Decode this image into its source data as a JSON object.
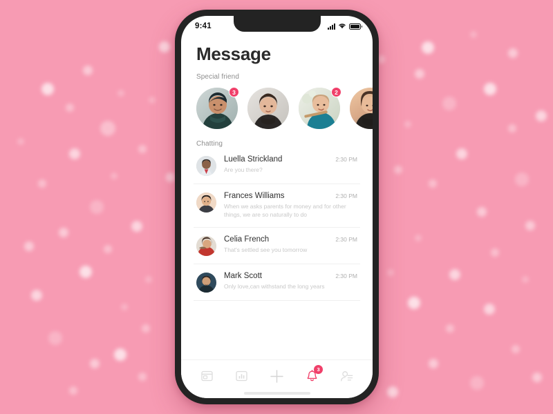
{
  "background": {
    "color": "#f79bb3",
    "accent": "#f0406a"
  },
  "status_bar": {
    "time": "9:41",
    "signal_icon": "signal-bars-icon",
    "wifi_icon": "wifi-icon",
    "battery_icon": "battery-icon"
  },
  "header": {
    "title": "Message"
  },
  "special_friend": {
    "label": "Special friend",
    "friends": [
      {
        "name": "friend-1",
        "badge": "3"
      },
      {
        "name": "friend-2",
        "badge": ""
      },
      {
        "name": "friend-3",
        "badge": "2"
      },
      {
        "name": "friend-4",
        "badge": ""
      }
    ]
  },
  "chatting": {
    "label": "Chatting",
    "rows": [
      {
        "name": "Luella Strickland",
        "preview": "Are you there?",
        "time": "2:30 PM"
      },
      {
        "name": "Frances Williams",
        "preview": "When we asks parents for money and for other things, we are so naturally to do",
        "time": "2:30 PM"
      },
      {
        "name": "Celia French",
        "preview": "That's settled see you tomorrow",
        "time": "2:30 PM"
      },
      {
        "name": "Mark Scott",
        "preview": "Only love,can withstand the long years",
        "time": "2:30 PM"
      }
    ]
  },
  "tabbar": {
    "items": [
      {
        "icon": "window-card-icon",
        "active": false,
        "badge": ""
      },
      {
        "icon": "bar-chart-icon",
        "active": false,
        "badge": ""
      },
      {
        "icon": "plus-icon",
        "active": false,
        "badge": ""
      },
      {
        "icon": "bell-icon",
        "active": true,
        "badge": "3"
      },
      {
        "icon": "contact-person-icon",
        "active": false,
        "badge": ""
      }
    ]
  }
}
